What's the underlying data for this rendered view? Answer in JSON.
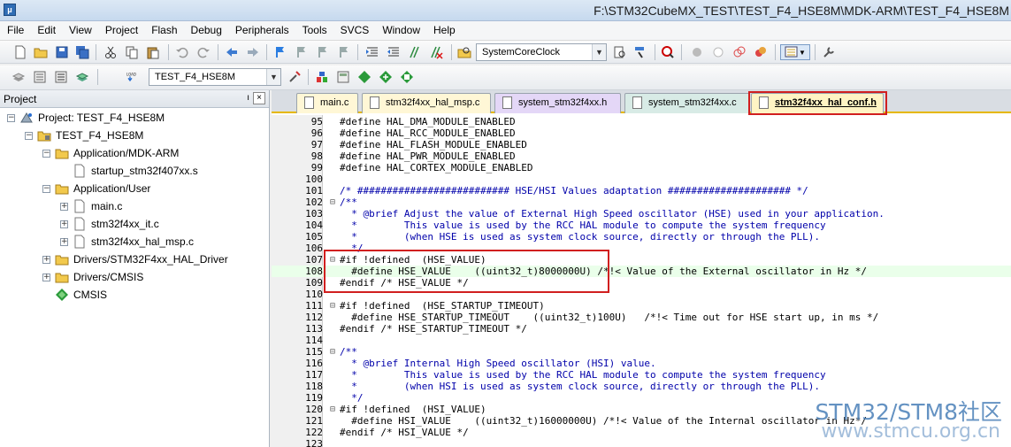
{
  "window": {
    "title": "F:\\STM32CubeMX_TEST\\TEST_F4_HSE8M\\MDK-ARM\\TEST_F4_HSE8M"
  },
  "menu": [
    "File",
    "Edit",
    "View",
    "Project",
    "Flash",
    "Debug",
    "Peripherals",
    "Tools",
    "SVCS",
    "Window",
    "Help"
  ],
  "toolbar": {
    "find_combo": "SystemCoreClock",
    "target_combo": "TEST_F4_HSE8M",
    "load_label": "LOAD"
  },
  "project_panel": {
    "title": "Project",
    "pin": "ı",
    "close": "×",
    "tree": [
      {
        "label": "Project: TEST_F4_HSE8M",
        "kind": "project"
      },
      {
        "label": "TEST_F4_HSE8M",
        "kind": "target"
      },
      {
        "label": "Application/MDK-ARM",
        "kind": "folder"
      },
      {
        "label": "startup_stm32f407xx.s",
        "kind": "file"
      },
      {
        "label": "Application/User",
        "kind": "folder"
      },
      {
        "label": "main.c",
        "kind": "file"
      },
      {
        "label": "stm32f4xx_it.c",
        "kind": "file"
      },
      {
        "label": "stm32f4xx_hal_msp.c",
        "kind": "file"
      },
      {
        "label": "Drivers/STM32F4xx_HAL_Driver",
        "kind": "folder"
      },
      {
        "label": "Drivers/CMSIS",
        "kind": "folder"
      },
      {
        "label": "CMSIS",
        "kind": "component"
      }
    ]
  },
  "tabs": [
    {
      "label": "main.c",
      "color": "#fff7d6"
    },
    {
      "label": "stm32f4xx_hal_msp.c",
      "color": "#fff7d6"
    },
    {
      "label": "system_stm32f4xx.h",
      "color": "#e4d7f7"
    },
    {
      "label": "system_stm32f4xx.c",
      "color": "#d8ebe6"
    },
    {
      "label": "stm32f4xx_hal_conf.h",
      "color": "#fff4c4",
      "active": true
    }
  ],
  "code_lines": [
    {
      "n": "95",
      "f": "",
      "t": "#define HAL_DMA_MODULE_ENABLED"
    },
    {
      "n": "96",
      "f": "",
      "t": "#define HAL_RCC_MODULE_ENABLED"
    },
    {
      "n": "97",
      "f": "",
      "t": "#define HAL_FLASH_MODULE_ENABLED"
    },
    {
      "n": "98",
      "f": "",
      "t": "#define HAL_PWR_MODULE_ENABLED"
    },
    {
      "n": "99",
      "f": "",
      "t": "#define HAL_CORTEX_MODULE_ENABLED"
    },
    {
      "n": "100",
      "f": "",
      "t": ""
    },
    {
      "n": "101",
      "f": "",
      "t": "/* ########################## HSE/HSI Values adaptation ##################### */",
      "c": true
    },
    {
      "n": "102",
      "f": "⊟",
      "t": "/**",
      "c": true
    },
    {
      "n": "103",
      "f": "",
      "t": "  * @brief Adjust the value of External High Speed oscillator (HSE) used in your application.",
      "c": true
    },
    {
      "n": "104",
      "f": "",
      "t": "  *        This value is used by the RCC HAL module to compute the system frequency",
      "c": true
    },
    {
      "n": "105",
      "f": "",
      "t": "  *        (when HSE is used as system clock source, directly or through the PLL).",
      "c": true
    },
    {
      "n": "106",
      "f": "",
      "t": "  */",
      "c": true
    },
    {
      "n": "107",
      "f": "⊟",
      "t": "#if !defined  (HSE_VALUE)"
    },
    {
      "n": "108",
      "f": "",
      "t": "  #define HSE_VALUE    ((uint32_t)8000000U) /*!< Value of the External oscillator in Hz */",
      "hl": true
    },
    {
      "n": "109",
      "f": "",
      "t": "#endif /* HSE_VALUE */"
    },
    {
      "n": "110",
      "f": "",
      "t": ""
    },
    {
      "n": "111",
      "f": "⊟",
      "t": "#if !defined  (HSE_STARTUP_TIMEOUT)"
    },
    {
      "n": "112",
      "f": "",
      "t": "  #define HSE_STARTUP_TIMEOUT    ((uint32_t)100U)   /*!< Time out for HSE start up, in ms */"
    },
    {
      "n": "113",
      "f": "",
      "t": "#endif /* HSE_STARTUP_TIMEOUT */"
    },
    {
      "n": "114",
      "f": "",
      "t": ""
    },
    {
      "n": "115",
      "f": "⊟",
      "t": "/**",
      "c": true
    },
    {
      "n": "116",
      "f": "",
      "t": "  * @brief Internal High Speed oscillator (HSI) value.",
      "c": true
    },
    {
      "n": "117",
      "f": "",
      "t": "  *        This value is used by the RCC HAL module to compute the system frequency",
      "c": true
    },
    {
      "n": "118",
      "f": "",
      "t": "  *        (when HSI is used as system clock source, directly or through the PLL).",
      "c": true
    },
    {
      "n": "119",
      "f": "",
      "t": "  */",
      "c": true
    },
    {
      "n": "120",
      "f": "⊟",
      "t": "#if !defined  (HSI_VALUE)"
    },
    {
      "n": "121",
      "f": "",
      "t": "  #define HSI_VALUE    ((uint32_t)16000000U) /*!< Value of the Internal oscillator in Hz*/"
    },
    {
      "n": "122",
      "f": "",
      "t": "#endif /* HSI_VALUE */"
    },
    {
      "n": "123",
      "f": "",
      "t": ""
    }
  ],
  "watermark": {
    "line1": "STM32/STM8社区",
    "line2": "www.stmcu.org.cn"
  },
  "colors": {
    "highlight_box": "#d11f1f",
    "comment": "#0000aa",
    "current_line": "#eaffea"
  }
}
